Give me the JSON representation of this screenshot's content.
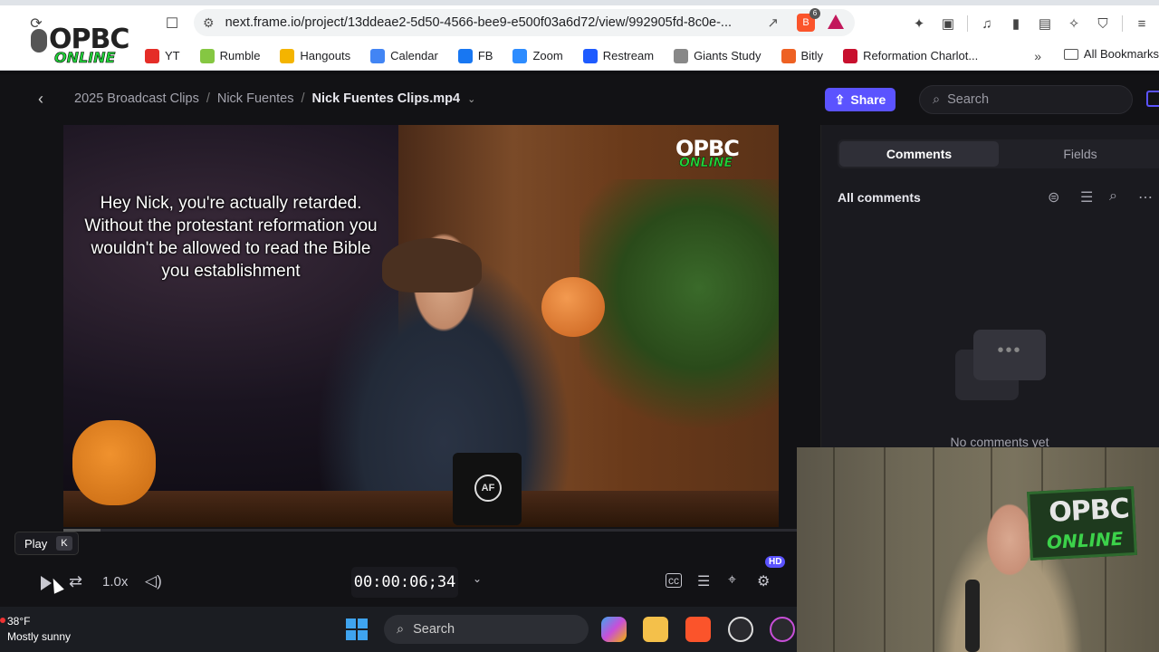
{
  "browser": {
    "url": "next.frame.io/project/13ddeae2-5d50-4566-bee9-e500f03a6d72/view/992905fd-8c0e-...",
    "brave_badge": "6",
    "bookmarks": [
      {
        "label": "YT",
        "color": "#e52d27"
      },
      {
        "label": "Rumble",
        "color": "#85c742"
      },
      {
        "label": "Hangouts",
        "color": "#f4b400"
      },
      {
        "label": "Calendar",
        "color": "#4285f4"
      },
      {
        "label": "FB",
        "color": "#1877f2"
      },
      {
        "label": "Zoom",
        "color": "#2d8cff"
      },
      {
        "label": "Restream",
        "color": "#1e5bff"
      },
      {
        "label": "Giants Study",
        "color": "#888888"
      },
      {
        "label": "Bitly",
        "color": "#ee6123"
      },
      {
        "label": "Reformation Charlot...",
        "color": "#c8102e"
      }
    ],
    "bookmark_more": "»",
    "all_bookmarks": "All Bookmarks",
    "logo_main": "OPBC",
    "logo_sub": "ONLINE"
  },
  "app": {
    "breadcrumb": [
      "2025 Broadcast Clips",
      "Nick Fuentes",
      "Nick Fuentes Clips.mp4"
    ],
    "share_label": "Share",
    "search_placeholder": "Search",
    "accent": "#5b53ff"
  },
  "video": {
    "caption": "Hey Nick, you're actually retarded. Without the protestant reformation you wouldn't be allowed to read the Bible you establishment",
    "watermark_main": "OPBC",
    "watermark_sub": "ONLINE",
    "mug_text": "AF"
  },
  "player": {
    "tooltip_label": "Play",
    "tooltip_key": "K",
    "speed": "1.0x",
    "timecode": "00:00:06;34",
    "quality_badge": "HD",
    "progress_fraction": 0.05
  },
  "panel": {
    "tabs": [
      "Comments",
      "Fields"
    ],
    "active_tab": "Comments",
    "section_title": "All comments",
    "empty_message": "No comments yet"
  },
  "webcam": {
    "logo_main": "OPBC",
    "logo_sub": "ONLINE"
  },
  "taskbar": {
    "temperature": "38°F",
    "condition": "Mostly sunny",
    "search_placeholder": "Search"
  }
}
